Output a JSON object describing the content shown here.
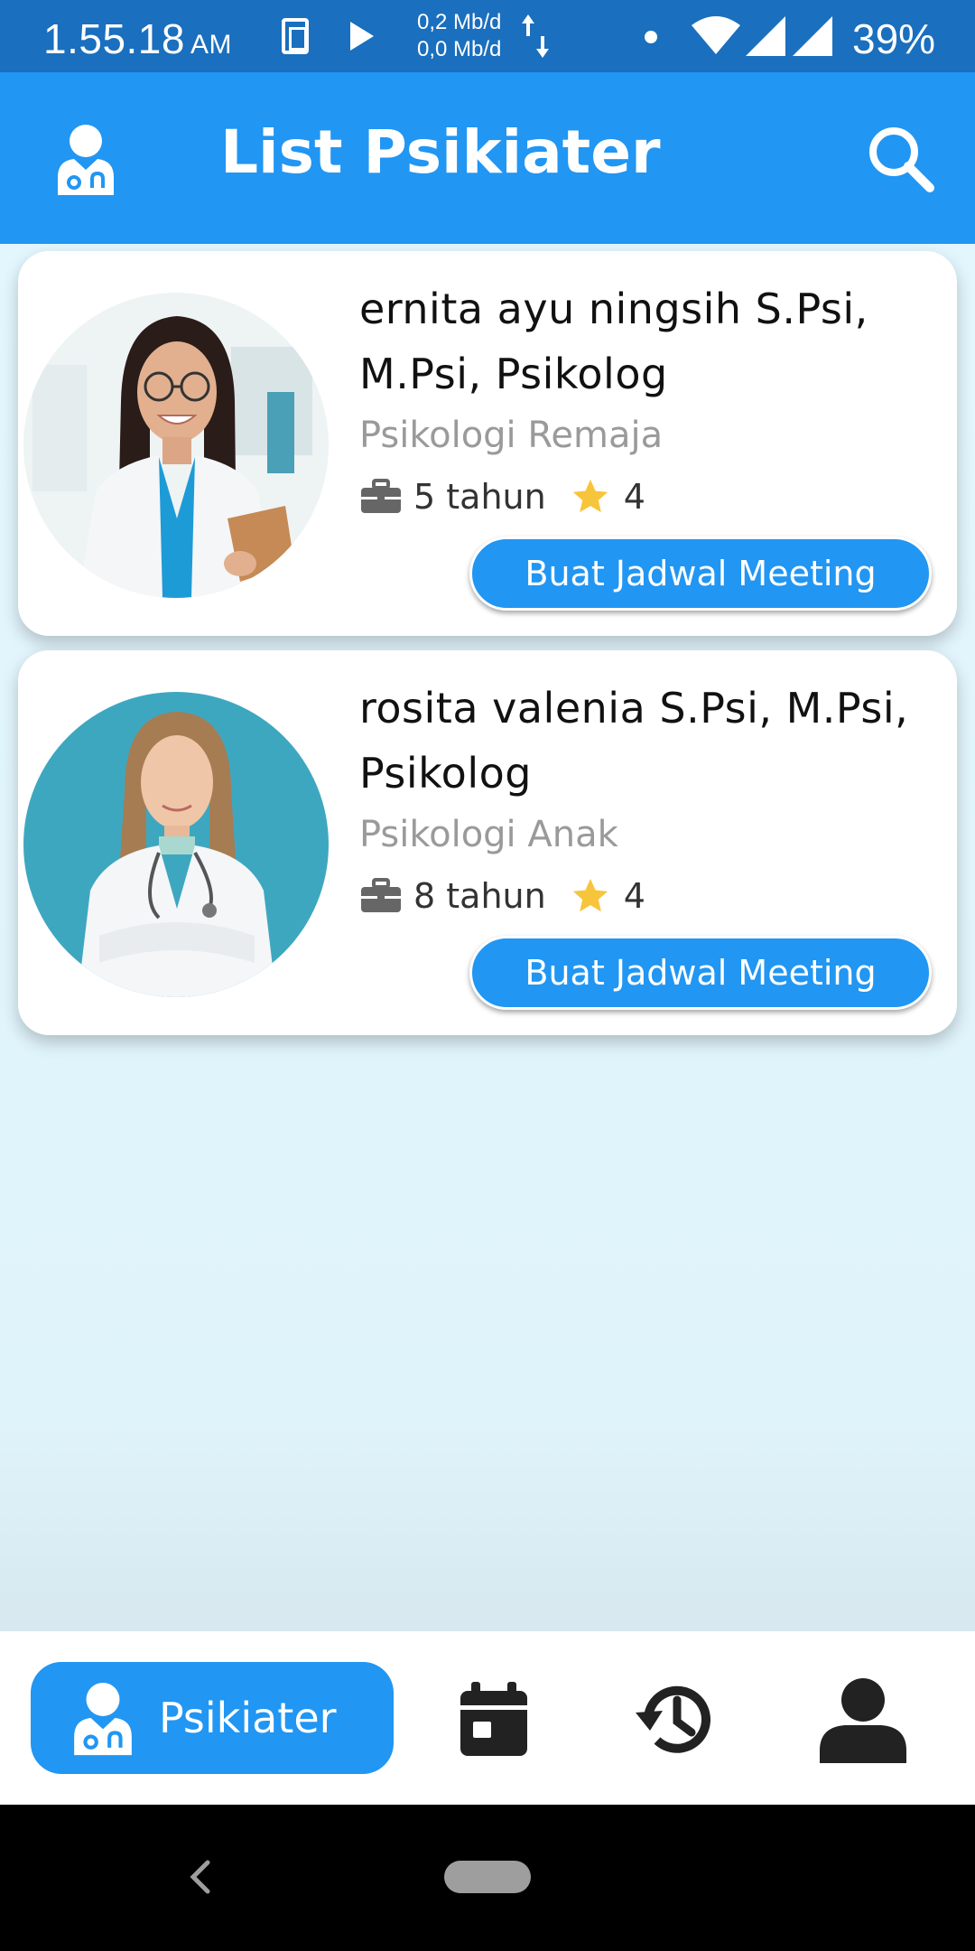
{
  "status_bar": {
    "time": "1.55.18",
    "ampm": "AM",
    "speed_up": "0,2 Mb/d",
    "speed_down": "0,0 Mb/d",
    "battery": "39%"
  },
  "app_bar": {
    "title": "List Psikiater",
    "color": "#2196f3"
  },
  "psychiatrists": [
    {
      "name": "ernita ayu ningsih  S.Psi, M.Psi, Psikolog",
      "specialty": "Psikologi Remaja",
      "experience": "5 tahun",
      "rating": "4",
      "button_label": "Buat Jadwal Meeting"
    },
    {
      "name": "rosita valenia S.Psi, M.Psi, Psikolog",
      "specialty": "Psikologi Anak",
      "experience": "8 tahun",
      "rating": "4",
      "button_label": "Buat Jadwal Meeting"
    }
  ],
  "bottom_nav": {
    "active_label": "Psikiater",
    "items": [
      "doctor-icon",
      "calendar-icon",
      "history-icon",
      "person-icon"
    ]
  },
  "colors": {
    "accent": "#2196f3",
    "status_bar": "#1a6fbe",
    "star": "#f7c53c",
    "background": "#e3f6fd"
  }
}
